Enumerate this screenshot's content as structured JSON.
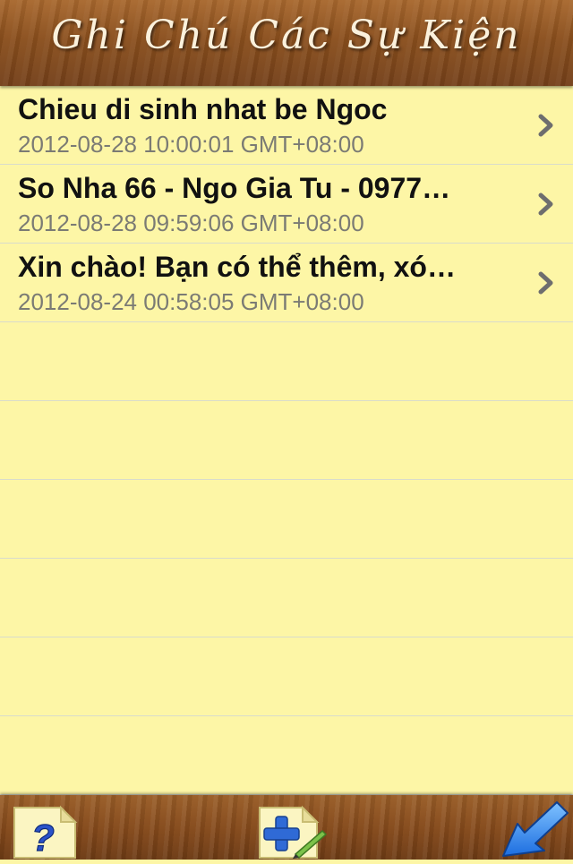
{
  "header": {
    "title": "Ghi Chú Các Sự Kiện"
  },
  "events": [
    {
      "title": "Chieu di sinh nhat be Ngoc",
      "date": "2012-08-28 10:00:01 GMT+08:00"
    },
    {
      "title": "So Nha 66 - Ngo Gia Tu - 0977…",
      "date": "2012-08-28 09:59:06 GMT+08:00"
    },
    {
      "title": "Xin chào! Bạn có thể thêm, xó…",
      "date": "2012-08-24 00:58:05 GMT+08:00"
    }
  ],
  "toolbar": {
    "help_icon": "help-note-icon",
    "add_icon": "add-note-icon",
    "back_icon": "back-arrow-icon"
  },
  "colors": {
    "paper": "#fdf6a6",
    "wood": "#8a4f1d",
    "date_text": "#7b7b74",
    "chevron": "#6e6e6e"
  }
}
